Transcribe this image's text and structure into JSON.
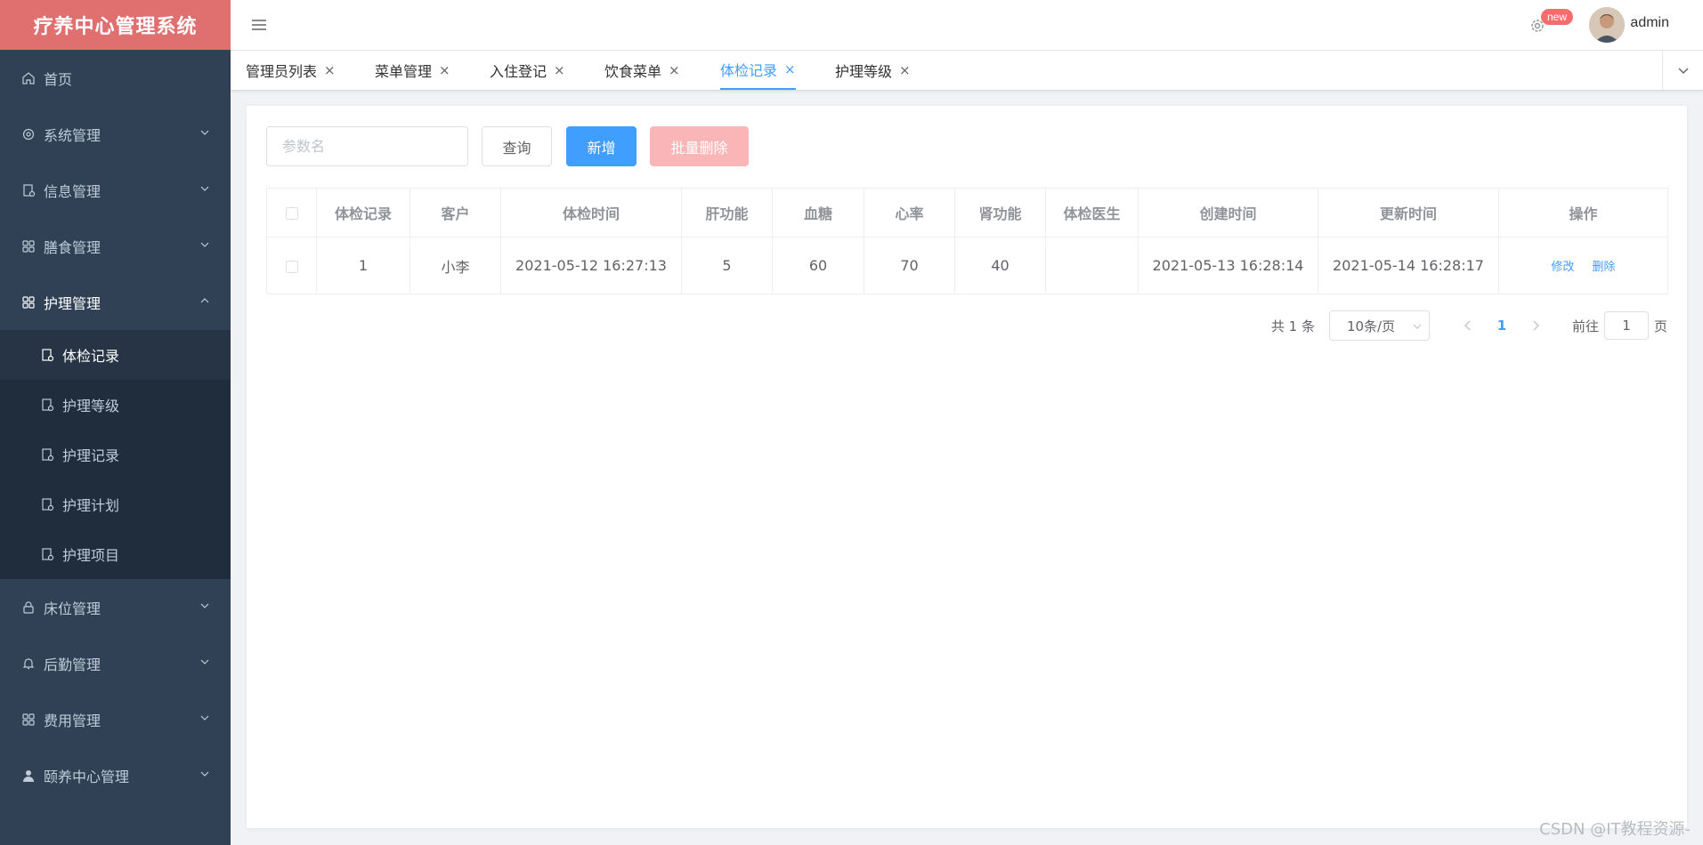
{
  "app": {
    "title": "疗养中心管理系统"
  },
  "sidebar": {
    "items": [
      {
        "label": "首页"
      },
      {
        "label": "系统管理"
      },
      {
        "label": "信息管理"
      },
      {
        "label": "膳食管理"
      },
      {
        "label": "护理管理"
      },
      {
        "label": "床位管理"
      },
      {
        "label": "后勤管理"
      },
      {
        "label": "费用管理"
      },
      {
        "label": "颐养中心管理"
      }
    ],
    "submenu": [
      {
        "label": "体检记录"
      },
      {
        "label": "护理等级"
      },
      {
        "label": "护理记录"
      },
      {
        "label": "护理计划"
      },
      {
        "label": "护理项目"
      }
    ]
  },
  "header": {
    "badge": "new",
    "username": "admin"
  },
  "tabs": [
    {
      "label": "管理员列表"
    },
    {
      "label": "菜单管理"
    },
    {
      "label": "入住登记"
    },
    {
      "label": "饮食菜单"
    },
    {
      "label": "体检记录"
    },
    {
      "label": "护理等级"
    }
  ],
  "toolbar": {
    "search_placeholder": "参数名",
    "query_label": "查询",
    "add_label": "新增",
    "batch_delete_label": "批量删除"
  },
  "table": {
    "columns": [
      "体检记录",
      "客户",
      "体检时间",
      "肝功能",
      "血糖",
      "心率",
      "肾功能",
      "体检医生",
      "创建时间",
      "更新时间",
      "操作"
    ],
    "rows": [
      {
        "id": "1",
        "customer": "小李",
        "exam_time": "2021-05-12 16:27:13",
        "liver": "5",
        "glucose": "60",
        "heart_rate": "70",
        "kidney": "40",
        "doctor": "",
        "created": "2021-05-13 16:28:14",
        "updated": "2021-05-14 16:28:17"
      }
    ],
    "edit_label": "修改",
    "delete_label": "删除"
  },
  "pagination": {
    "total": "共 1 条",
    "page_size": "10条/页",
    "current_page": "1",
    "goto_prefix": "前往",
    "goto_value": "1",
    "goto_suffix": "页"
  },
  "watermark": "CSDN @IT教程资源-",
  "colors": {
    "brand": "#e07070",
    "sidebar": "#304156",
    "primary": "#409eff",
    "danger_light": "#fab6b6"
  }
}
